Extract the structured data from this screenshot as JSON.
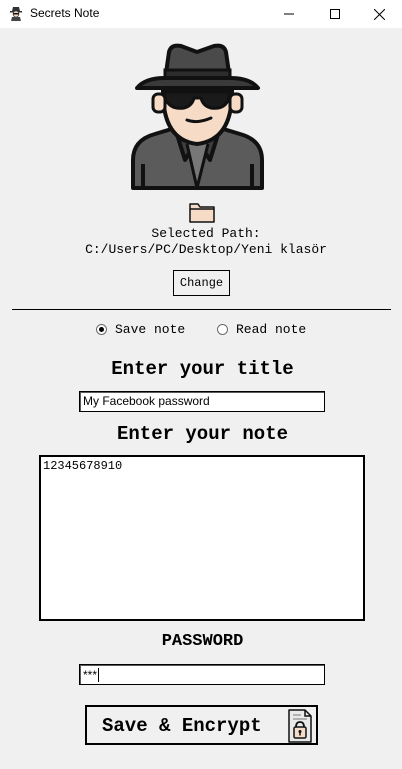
{
  "window": {
    "title": "Secrets Note"
  },
  "path": {
    "label": "Selected Path:",
    "value": "C:/Users/PC/Desktop/Yeni klasör",
    "change_label": "Change"
  },
  "mode": {
    "options": [
      {
        "label": "Save note",
        "selected": true
      },
      {
        "label": "Read note",
        "selected": false
      }
    ]
  },
  "title_section": {
    "heading": "Enter your title",
    "value": "My Facebook password"
  },
  "note_section": {
    "heading": "Enter your note",
    "value": "12345678910"
  },
  "password_section": {
    "heading": "PASSWORD",
    "value": "***"
  },
  "actions": {
    "save_encrypt_label": "Save & Encrypt"
  }
}
